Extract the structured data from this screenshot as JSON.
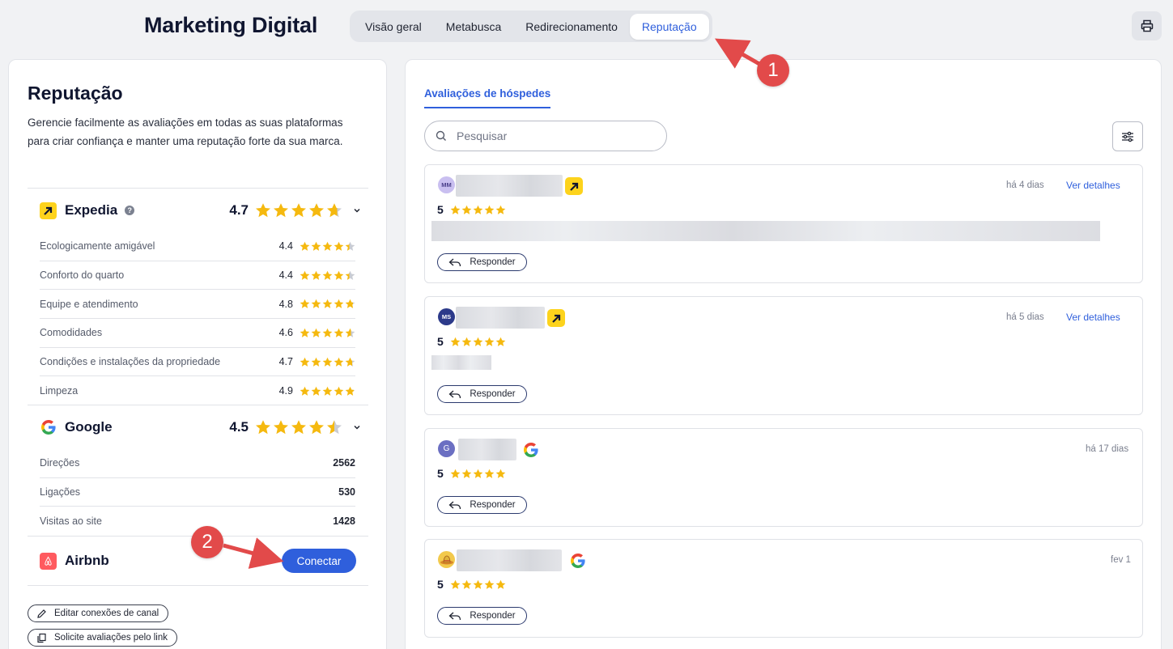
{
  "header": {
    "title": "Marketing Digital",
    "tabs": [
      {
        "label": "Visão geral",
        "active": false
      },
      {
        "label": "Metabusca",
        "active": false
      },
      {
        "label": "Redirecionamento",
        "active": false
      },
      {
        "label": "Reputação",
        "active": true
      }
    ],
    "print_icon": "printer-icon"
  },
  "reputation": {
    "title": "Reputação",
    "description": "Gerencie facilmente as avaliações em todas as suas plataformas para criar confiança e manter uma reputação forte da sua marca.",
    "expedia": {
      "name": "Expedia",
      "score": "4.7",
      "rows": [
        {
          "label": "Ecologicamente amigável",
          "value": "4.4",
          "stars": 4.4
        },
        {
          "label": "Conforto do quarto",
          "value": "4.4",
          "stars": 4.4
        },
        {
          "label": "Equipe e atendimento",
          "value": "4.8",
          "stars": 4.8
        },
        {
          "label": "Comodidades",
          "value": "4.6",
          "stars": 4.6
        },
        {
          "label": "Condições e instalações da propriedade",
          "value": "4.7",
          "stars": 4.7
        },
        {
          "label": "Limpeza",
          "value": "4.9",
          "stars": 4.9
        }
      ]
    },
    "google": {
      "name": "Google",
      "score": "4.5",
      "rows": [
        {
          "label": "Direções",
          "value": "2562"
        },
        {
          "label": "Ligações",
          "value": "530"
        },
        {
          "label": "Visitas ao site",
          "value": "1428"
        }
      ]
    },
    "airbnb": {
      "name": "Airbnb",
      "connect_label": "Conectar"
    },
    "edit_connections_label": "Editar conexões de canal",
    "request_reviews_label": "Solicite avaliações pelo link"
  },
  "reviews": {
    "tab_label": "Avaliações de hóspedes",
    "search_placeholder": "Pesquisar",
    "items": [
      {
        "initials": "MM",
        "source": "expedia",
        "date": "há 4 dias",
        "link": "Ver detalhes",
        "score": "5",
        "reply_label": "Responder"
      },
      {
        "initials": "MS",
        "source": "expedia",
        "date": "há 5 dias",
        "link": "Ver detalhes",
        "score": "5",
        "reply_label": "Responder"
      },
      {
        "initials": "G",
        "source": "google",
        "date": "há 17 dias",
        "link": "",
        "score": "5",
        "reply_label": "Responder"
      },
      {
        "initials": "",
        "source": "google",
        "date": "fev 1",
        "link": "",
        "score": "5",
        "reply_label": "Responder"
      }
    ]
  },
  "annotations": [
    "1",
    "2"
  ],
  "colors": {
    "accent": "#2f5fdc",
    "star": "#f5b90f",
    "expedia": "#fdd31c",
    "airbnb": "#ff5a5f",
    "annotation": "#e24a4a"
  }
}
